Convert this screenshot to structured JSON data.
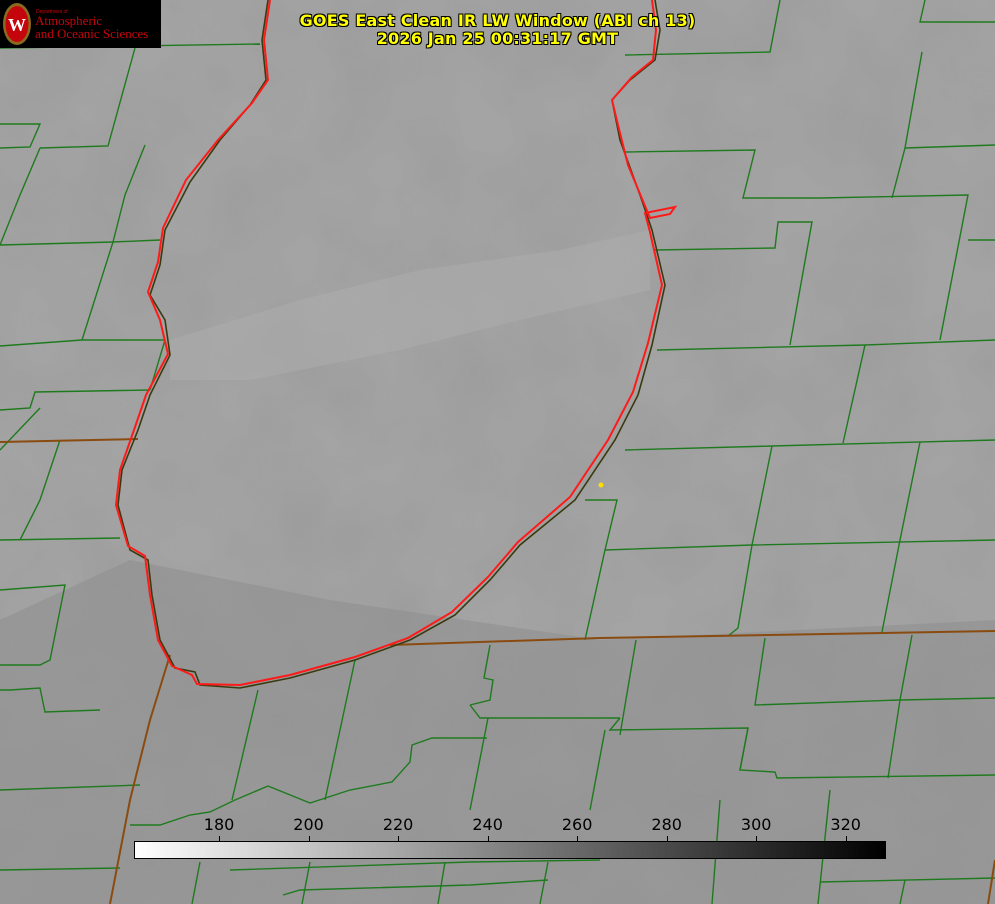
{
  "title": {
    "line1": "GOES East Clean IR LW Window (ABI ch 13)",
    "line2": "2026 Jan 25 00:31:17 GMT"
  },
  "logo": {
    "dept": "Department of",
    "line1": "Atmospheric",
    "line2": "and Oceanic Sciences",
    "seal_letter": "W"
  },
  "colorbar": {
    "vmin": 161,
    "vmax": 329,
    "ticks": [
      180,
      200,
      220,
      240,
      260,
      280,
      300,
      320
    ],
    "colormap": "white-to-black"
  },
  "colors": {
    "background_gray": "#999999",
    "county_lines": "#1f7a1f",
    "state_lines": "#8a4b10",
    "shoreline": "#ff1a1a",
    "title_text": "#ffff00",
    "logo_red": "#c5050c"
  }
}
